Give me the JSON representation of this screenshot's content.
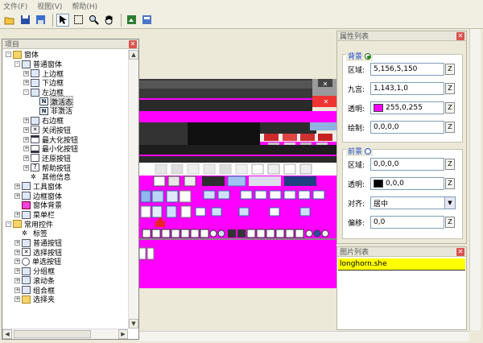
{
  "menu": [
    "文件(F)",
    "视图(V)",
    "帮助(H)"
  ],
  "toolbar_icons": [
    "open-icon",
    "save-icon",
    "save-as-icon",
    "pointer-icon",
    "marquee-icon",
    "zoom-icon",
    "hand-icon",
    "preview-icon",
    "export-icon"
  ],
  "project_panel": {
    "title": "项目",
    "tree": [
      {
        "label": "窗体",
        "depth": 0,
        "expander": "-",
        "icon": "folder"
      },
      {
        "label": "普通窗体",
        "depth": 1,
        "expander": "-",
        "icon": "window"
      },
      {
        "label": "上边框",
        "depth": 2,
        "expander": "+",
        "icon": "window"
      },
      {
        "label": "下边框",
        "depth": 2,
        "expander": "+",
        "icon": "window"
      },
      {
        "label": "左边框",
        "depth": 2,
        "expander": "-",
        "icon": "window"
      },
      {
        "label": "激活态",
        "depth": 3,
        "expander": "",
        "icon": "n",
        "selected": true
      },
      {
        "label": "非激活",
        "depth": 3,
        "expander": "",
        "icon": "n"
      },
      {
        "label": "右边框",
        "depth": 2,
        "expander": "+",
        "icon": "window"
      },
      {
        "label": "关闭按钮",
        "depth": 2,
        "expander": "+",
        "icon": "close"
      },
      {
        "label": "最大化按钮",
        "depth": 2,
        "expander": "+",
        "icon": "max"
      },
      {
        "label": "最小化按钮",
        "depth": 2,
        "expander": "+",
        "icon": "min"
      },
      {
        "label": "还原按钮",
        "depth": 2,
        "expander": "+",
        "icon": "restore"
      },
      {
        "label": "帮助按钮",
        "depth": 2,
        "expander": "+",
        "icon": "help"
      },
      {
        "label": "其他信息",
        "depth": 2,
        "expander": "",
        "icon": "gear"
      },
      {
        "label": "工具窗体",
        "depth": 1,
        "expander": "+",
        "icon": "window"
      },
      {
        "label": "边框窗体",
        "depth": 1,
        "expander": "+",
        "icon": "window"
      },
      {
        "label": "窗体背景",
        "depth": 1,
        "expander": "",
        "icon": "pink"
      },
      {
        "label": "菜单栏",
        "depth": 1,
        "expander": "+",
        "icon": "window"
      },
      {
        "label": "常用控件",
        "depth": 0,
        "expander": "-",
        "icon": "folder"
      },
      {
        "label": "标签",
        "depth": 1,
        "expander": "",
        "icon": "gear"
      },
      {
        "label": "普通按钮",
        "depth": 1,
        "expander": "+",
        "icon": "window"
      },
      {
        "label": "选择按钮",
        "depth": 1,
        "expander": "+",
        "icon": "close"
      },
      {
        "label": "单选按钮",
        "depth": 1,
        "expander": "+",
        "icon": "radio"
      },
      {
        "label": "分组框",
        "depth": 1,
        "expander": "+",
        "icon": "window"
      },
      {
        "label": "滚动条",
        "depth": 1,
        "expander": "+",
        "icon": "window"
      },
      {
        "label": "组合框",
        "depth": 1,
        "expander": "+",
        "icon": "window"
      },
      {
        "label": "选择夹",
        "depth": 1,
        "expander": "+",
        "icon": "folder"
      }
    ]
  },
  "property_panel": {
    "title": "属性列表",
    "background_group": {
      "title": "背景",
      "fields": [
        {
          "label": "区域:",
          "value": "5,156,5,150"
        },
        {
          "label": "九宫:",
          "value": "1,143,1,0"
        },
        {
          "label": "透明:",
          "value": "255,0,255",
          "swatch": "#ff00ff"
        },
        {
          "label": "绘制:",
          "value": "0,0,0,0"
        }
      ]
    },
    "foreground_group": {
      "title": "前景",
      "fields": [
        {
          "label": "区域:",
          "value": "0,0,0,0"
        },
        {
          "label": "透明:",
          "value": "0,0,0",
          "swatch": "#000000"
        },
        {
          "label": "对齐:",
          "value": "居中",
          "dropdown": true
        },
        {
          "label": "偏移:",
          "value": "0,0"
        }
      ]
    },
    "z_label": "Z"
  },
  "image_panel": {
    "title": "图片列表",
    "items": [
      "longhorn.she"
    ]
  },
  "colors": {
    "magenta": "#ff00ff",
    "selection_yellow": "#ffff00",
    "title_blue": "#1c48c8"
  }
}
